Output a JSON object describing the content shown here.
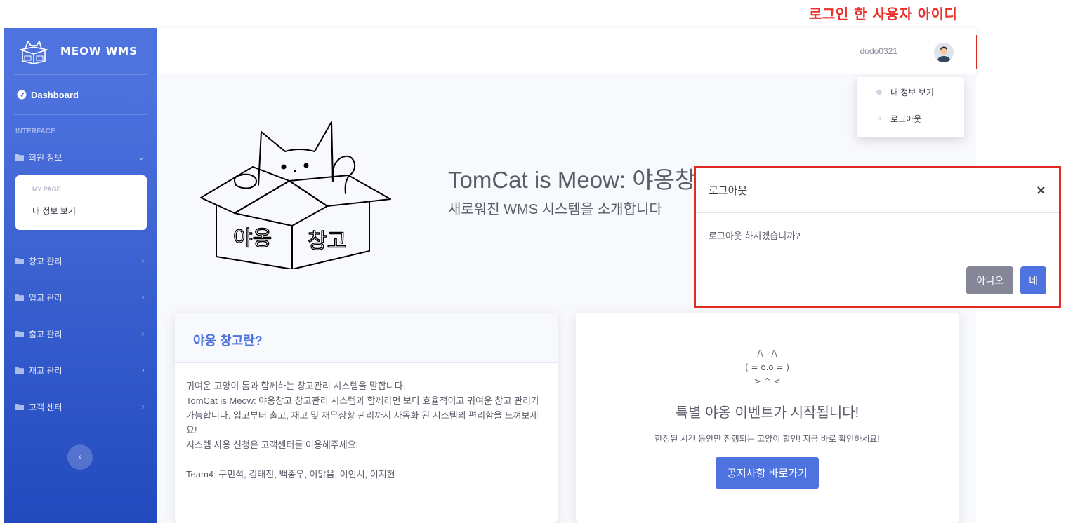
{
  "annotation": {
    "title": "로그인 한 사용자 아이디"
  },
  "sidebar": {
    "brand": "MEOW WMS",
    "dashboard": "Dashboard",
    "heading": "INTERFACE",
    "member_section": {
      "label": "회원 정보",
      "sub_header": "MY PAGE",
      "sub_item": "내 정보 보기"
    },
    "items": [
      {
        "label": "창고 관리"
      },
      {
        "label": "입고 관리"
      },
      {
        "label": "출고 관리"
      },
      {
        "label": "재고 관리"
      },
      {
        "label": "고객 센터"
      }
    ]
  },
  "topbar": {
    "username": "dodo0321"
  },
  "dropdown": {
    "items": [
      {
        "label": "내 정보 보기"
      },
      {
        "label": "로그아웃"
      }
    ]
  },
  "hero": {
    "title": "TomCat is Meow: 야옹창고",
    "subtitle": "새로워진 WMS 시스템을 소개합니다"
  },
  "intro_card": {
    "title": "야옹 창고란?",
    "lines": [
      "귀여운 고양이 톰과 함께하는 창고관리 시스템을 말합니다.",
      "TomCat is Meow: 야옹창고 창고관리 시스템과 함께라면 보다 효율적이고 귀여운 창고 관리가 가능합니다. 입고부터 출고, 재고 및 재무상황 관리까지 자동화 된 시스템의 편리함을 느껴보세요!",
      "시스템 사용 신청은 고객센터를 이용해주세요!"
    ],
    "team": "Team4: 구민석, 김태진, 백종우, 이맑음, 이인서, 이지현"
  },
  "event_card": {
    "ascii_line1": "/\\__/\\",
    "ascii_line2": "( = o.o = )",
    "ascii_line3": "> ^ <",
    "title": "특별 야옹 이벤트가 시작됩니다!",
    "description": "한정된 시간 동안만 진행되는 고양이 할인! 지금 바로 확인하세요!",
    "button": "공지사항 바로가기"
  },
  "modal": {
    "title": "로그아웃",
    "close": "×",
    "body": "로그아웃 하시겠습니까?",
    "cancel": "아니오",
    "confirm": "네"
  },
  "colors": {
    "primary": "#4e73df",
    "annotation": "#e02b25",
    "secondary": "#858796"
  }
}
